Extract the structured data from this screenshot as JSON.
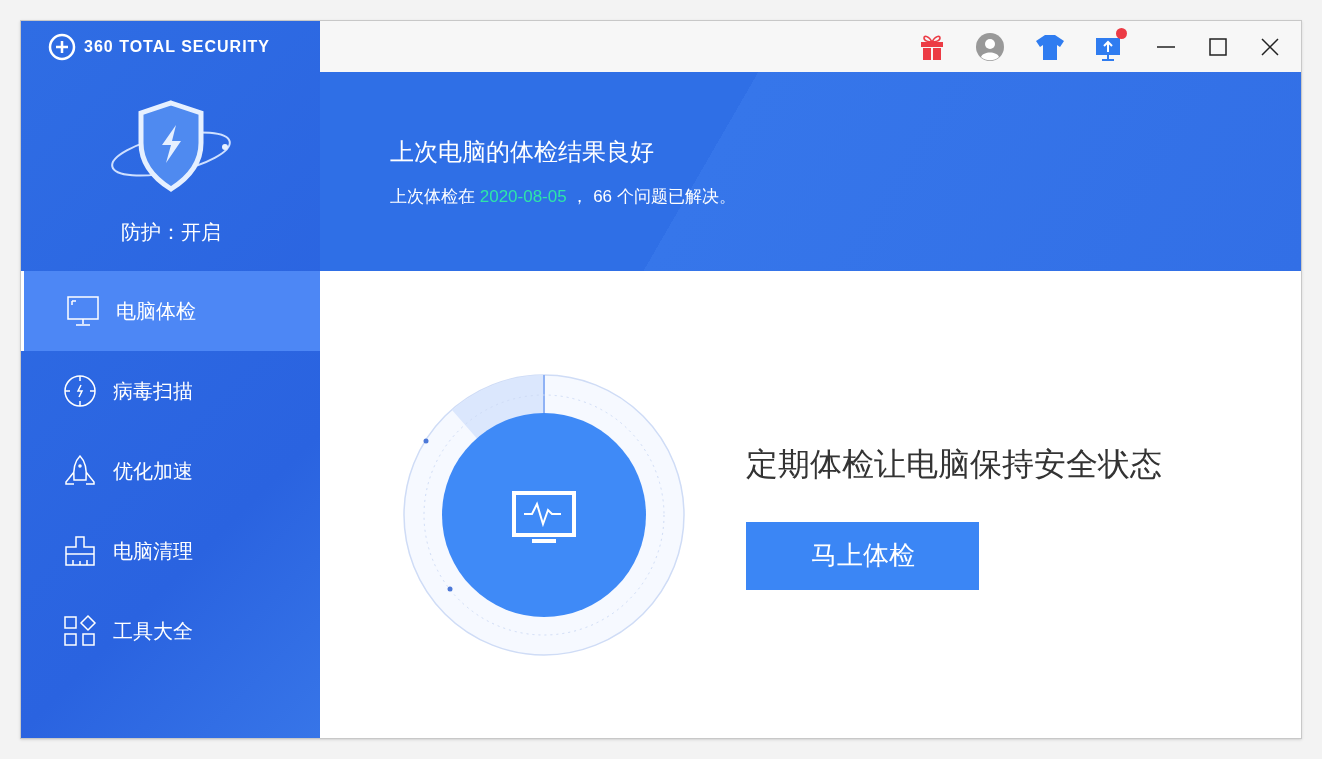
{
  "app": {
    "logo_text": "360 TOTAL SECURITY",
    "protection_status": "防护：开启"
  },
  "toolbar": {
    "update_badge": true
  },
  "sidebar": {
    "items": [
      {
        "label": "电脑体检",
        "kind": "checkup",
        "selected": true
      },
      {
        "label": "病毒扫描",
        "kind": "scan",
        "selected": false
      },
      {
        "label": "优化加速",
        "kind": "speedup",
        "selected": false
      },
      {
        "label": "电脑清理",
        "kind": "cleanup",
        "selected": false
      },
      {
        "label": "工具大全",
        "kind": "tools",
        "selected": false
      }
    ]
  },
  "header": {
    "title": "上次电脑的体检结果良好",
    "subtitle_prefix": "上次体检在",
    "date": "2020-08-05",
    "subtitle_suffix": "， 66 个问题已解决。"
  },
  "main": {
    "message": "定期体检让电脑保持安全状态",
    "button": "马上体检"
  }
}
